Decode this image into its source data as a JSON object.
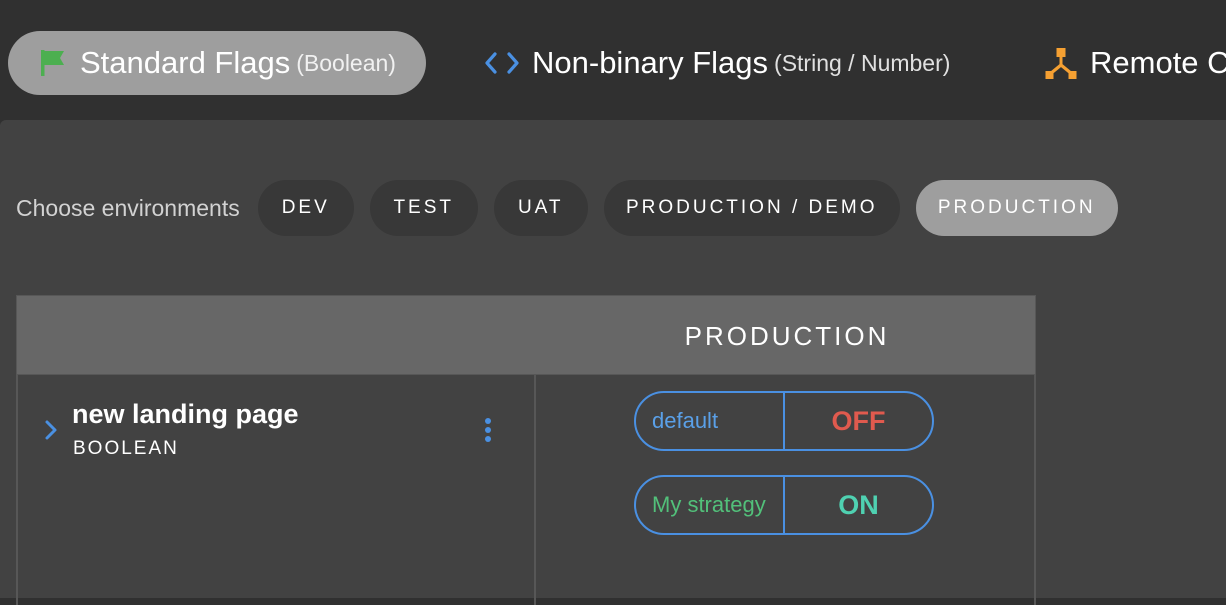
{
  "tabs": [
    {
      "label": "Standard Flags",
      "sub": "(Boolean)",
      "icon": "flag-icon",
      "selected": true
    },
    {
      "label": "Non-binary Flags",
      "sub": "(String / Number)",
      "icon": "code-icon",
      "selected": false
    },
    {
      "label": "Remote C",
      "sub": "",
      "icon": "remote-config-icon",
      "selected": false
    }
  ],
  "environments": {
    "label": "Choose environments",
    "chips": [
      "DEV",
      "TEST",
      "UAT",
      "PRODUCTION / DEMO",
      "PRODUCTION"
    ],
    "selected": "PRODUCTION"
  },
  "table": {
    "column_header": "PRODUCTION",
    "flag": {
      "name": "new landing page",
      "type": "BOOLEAN"
    },
    "strategies": [
      {
        "name": "default",
        "value": "OFF",
        "name_color": "#5aa0e8",
        "value_color": "#e05a4e"
      },
      {
        "name": "My strategy",
        "value": "ON",
        "name_color": "#52c07a",
        "value_color": "#4fd1b1"
      }
    ]
  },
  "colors": {
    "accent_blue": "#4a90e2",
    "flag_green": "#4caf50",
    "remote_orange": "#f5a032"
  }
}
